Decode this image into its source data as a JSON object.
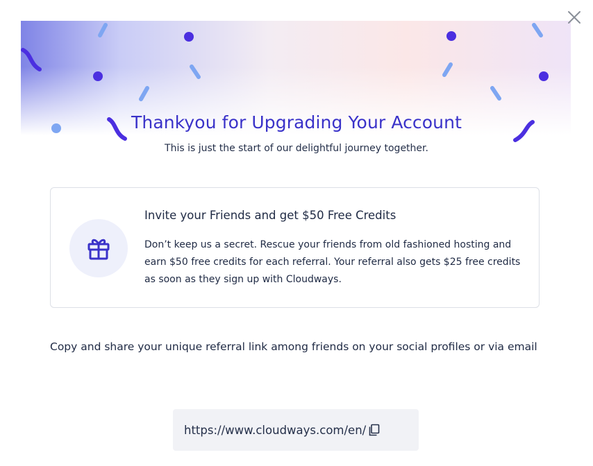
{
  "modal": {
    "close_icon": "close-icon",
    "title": "Thankyou for Upgrading Your Account",
    "subtitle": "This is just the start of our delightful journey together."
  },
  "referral_card": {
    "icon": "gift-icon",
    "title": "Invite your Friends and get $50 Free Credits",
    "body": "Don’t keep us a secret. Rescue your friends from old fashioned hosting and earn $50 free credits for each referral. Your referral also gets $25 free credits as soon as they sign up with Cloudways."
  },
  "share": {
    "text": "Copy and share your unique referral link among friends on your social profiles or via email",
    "link": "https://www.cloudways.com/en/",
    "copy_icon": "copy-icon"
  },
  "colors": {
    "accent": "#3a32c9",
    "confetti_purple": "#4b2fe0",
    "confetti_blue": "#7ea6f2",
    "card_border": "#dcdfe6",
    "link_box_bg": "#f1f2f6"
  }
}
